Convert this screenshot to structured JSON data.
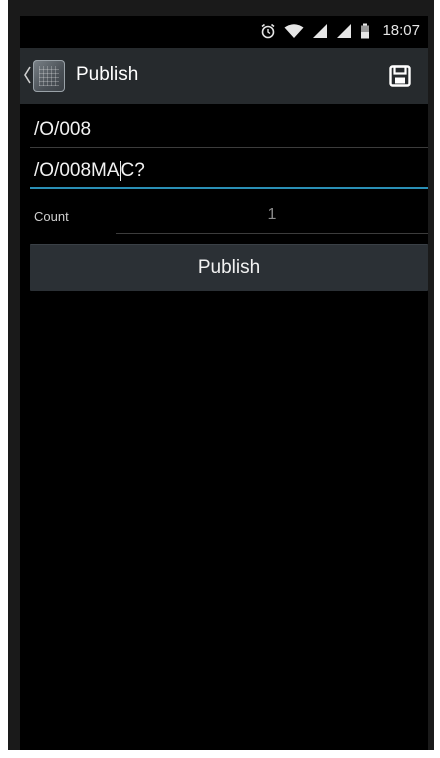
{
  "status_bar": {
    "time": "18:07",
    "icons": [
      "alarm-icon",
      "wifi-icon",
      "signal-icon",
      "signal-icon",
      "battery-icon"
    ]
  },
  "action_bar": {
    "title": "Publish",
    "up_icon": "chevron-left-icon",
    "app_icon": "app-icon",
    "save_icon": "floppy-disk-icon"
  },
  "form": {
    "topic": "/O/008",
    "message_before_cursor": "/O/008MA",
    "message_after_cursor": "C?",
    "count_label": "Count",
    "count_value": "1",
    "publish_label": "Publish"
  },
  "colors": {
    "action_bar_bg": "#262a2d",
    "focus_underline": "#2a8fb5",
    "button_bg": "#2b3035"
  }
}
